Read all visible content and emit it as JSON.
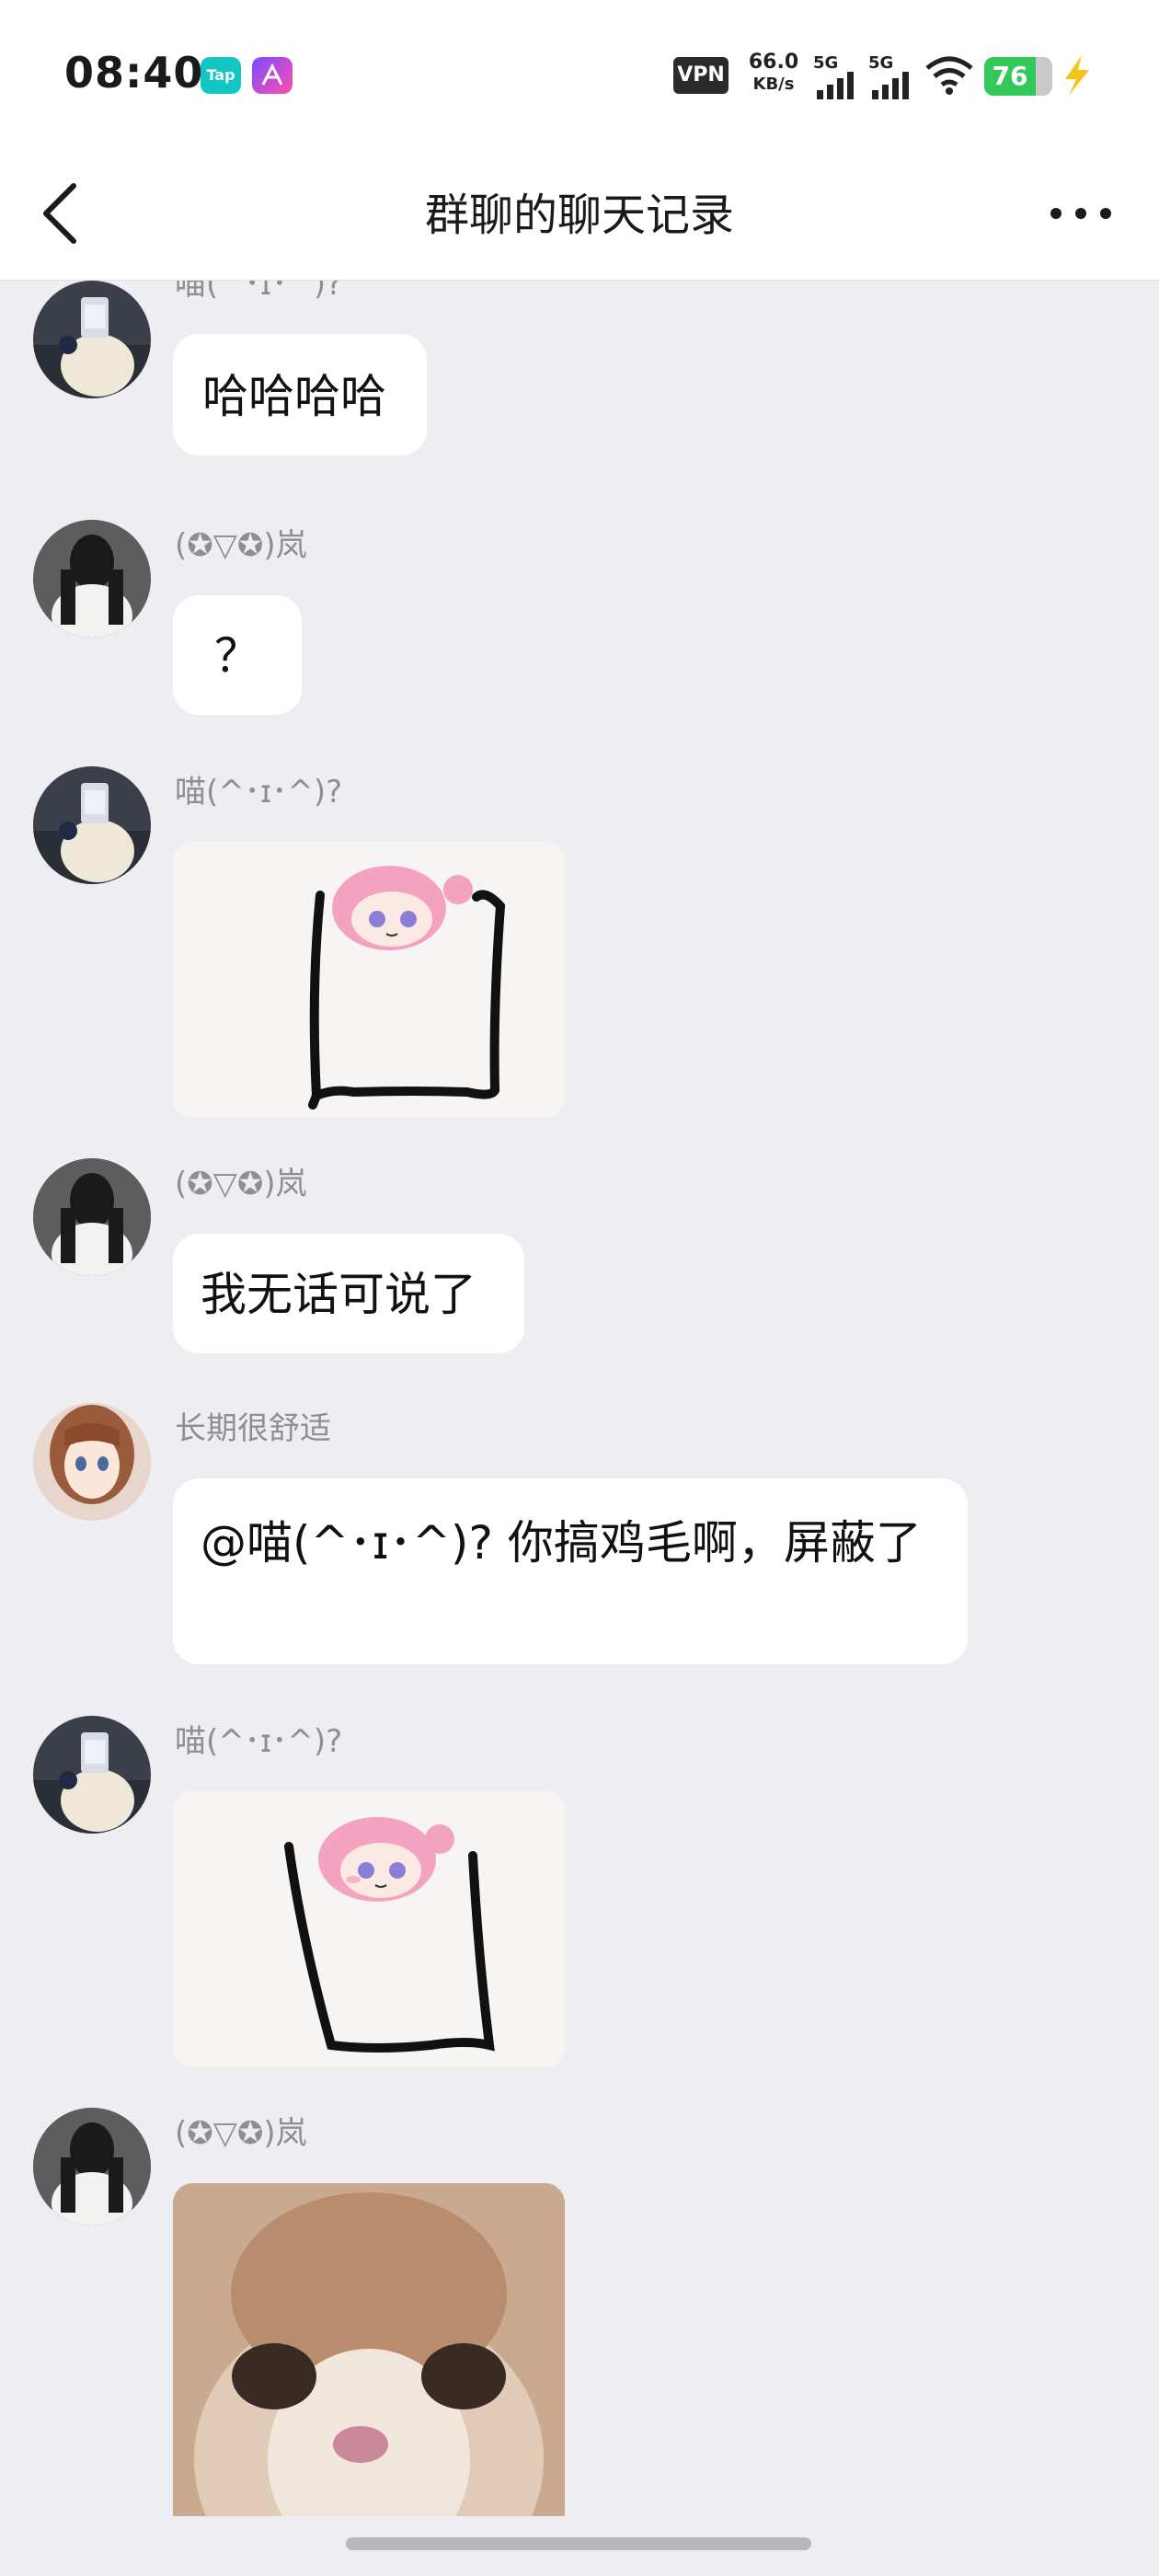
{
  "status_bar": {
    "time": "08:40",
    "tap_badge": "Tap",
    "vpn": "VPN",
    "speed_value": "66.0",
    "speed_unit": "KB/s",
    "signal1_label": "5G",
    "signal2_label": "5G",
    "battery_level": "76",
    "battery_fraction": 0.76
  },
  "header": {
    "title": "群聊的聊天记录"
  },
  "messages": [
    {
      "sender": "喵(^･ɪ･^)?",
      "text": "哈哈哈哈"
    },
    {
      "sender": "(✪▽✪)岚",
      "text": "？"
    },
    {
      "sender": "喵(^･ɪ･^)?",
      "sticker": "anime-girl-box-sticker"
    },
    {
      "sender": "(✪▽✪)岚",
      "text": "我无话可说了"
    },
    {
      "sender": "长期很舒适",
      "text": "@喵(^･ɪ･^)?  你搞鸡毛啊，屏蔽了"
    },
    {
      "sender": "喵(^･ɪ･^)?",
      "sticker": "anime-girl-box-sticker"
    },
    {
      "sender": "(✪▽✪)岚",
      "sticker": "cat-face-sticker"
    }
  ],
  "colors": {
    "background": "#eeeef2",
    "bubble": "#ffffff",
    "sender_text": "#8e8e93",
    "battery_green": "#34c85a"
  }
}
